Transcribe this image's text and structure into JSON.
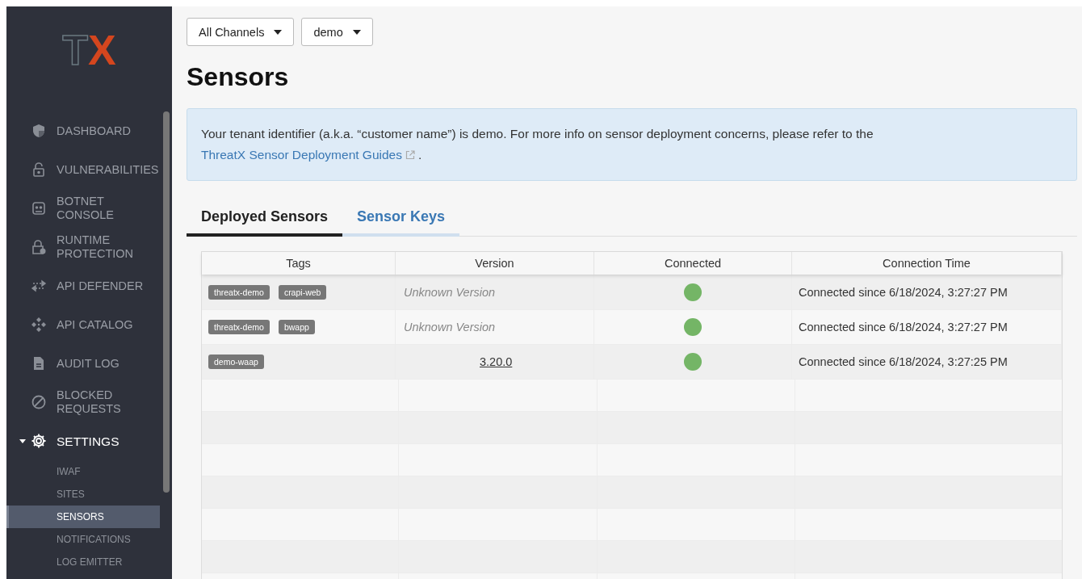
{
  "sidebar": {
    "logo": {
      "letters": [
        "T",
        "X"
      ]
    },
    "items": [
      {
        "label": "DASHBOARD",
        "selected": false
      },
      {
        "label": "VULNERABILITIES",
        "selected": false
      },
      {
        "label": "BOTNET CONSOLE",
        "selected": false
      },
      {
        "label": "RUNTIME PROTECTION",
        "selected": false
      },
      {
        "label": "API DEFENDER",
        "selected": false
      },
      {
        "label": "API CATALOG",
        "selected": false
      },
      {
        "label": "AUDIT LOG",
        "selected": false
      },
      {
        "label": "BLOCKED REQUESTS",
        "selected": false
      },
      {
        "label": "SETTINGS",
        "selected": false,
        "expanded": true,
        "children": [
          {
            "label": "IWAF",
            "selected": false
          },
          {
            "label": "SITES",
            "selected": false
          },
          {
            "label": "SENSORS",
            "selected": true
          },
          {
            "label": "NOTIFICATIONS",
            "selected": false
          },
          {
            "label": "LOG EMITTER",
            "selected": false
          }
        ]
      }
    ]
  },
  "filters": [
    {
      "label": "All Channels"
    },
    {
      "label": "demo"
    }
  ],
  "title": "Sensors",
  "notice": {
    "text": "Your tenant identifier (a.k.a. “customer name”) is demo. For more info on sensor deployment concerns, please refer to the",
    "link": "ThreatX Sensor Deployment Guides",
    "after": "."
  },
  "tabs": [
    {
      "label": "Deployed Sensors",
      "selected": true
    },
    {
      "label": "Sensor Keys",
      "selected": false
    }
  ],
  "table": {
    "columns": [
      "Tags",
      "Version",
      "Connected",
      "Connection Time"
    ],
    "rows": [
      {
        "tags": [
          "threatx-demo",
          "crapi-web"
        ],
        "version": {
          "kind": "unknown",
          "text": "Unknown Version"
        },
        "connected": true,
        "time": "Connected since 6/18/2024, 3:27:27 PM"
      },
      {
        "tags": [
          "threatx-demo",
          "bwapp"
        ],
        "version": {
          "kind": "unknown",
          "text": "Unknown Version"
        },
        "connected": true,
        "time": "Connected since 6/18/2024, 3:27:27 PM"
      },
      {
        "tags": [
          "demo-waap"
        ],
        "version": {
          "kind": "number",
          "text": "3.20.0"
        },
        "connected": true,
        "time": "Connected since 6/18/2024, 3:27:25 PM"
      }
    ]
  }
}
